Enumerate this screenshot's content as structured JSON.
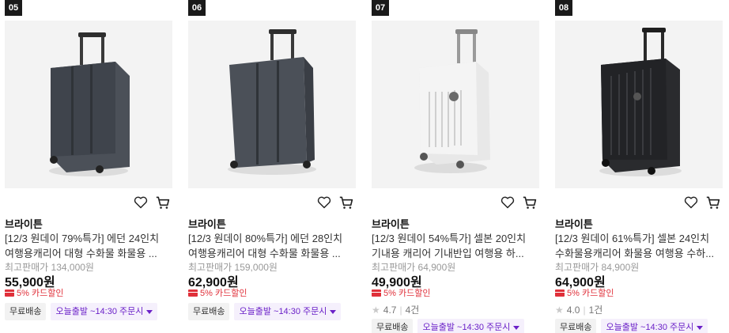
{
  "products": [
    {
      "rank": "05",
      "brand": "브라이튼",
      "title": "[12/3 원데이 79%특가] 에던 24인치 여행용캐리어 대형 수화물 화물용 ...",
      "orig_price": "최고판매가 134,000원",
      "price": "55,900원",
      "discount": "5% 카드할인",
      "rating": null,
      "tags": [
        "무료배송",
        "오늘출발 ~14:30 주문시"
      ],
      "color": "dark-gray"
    },
    {
      "rank": "06",
      "brand": "브라이튼",
      "title": "[12/3 원데이 80%특가] 에던 28인치 여행용캐리어 대형 수화물 화물용 ...",
      "orig_price": "최고판매가 159,000원",
      "price": "62,900원",
      "discount": "5% 카드할인",
      "rating": null,
      "tags": [
        "무료배송",
        "오늘출발 ~14:30 주문시"
      ],
      "color": "dark-gray"
    },
    {
      "rank": "07",
      "brand": "브라이튼",
      "title": "[12/3 원데이 54%특가] 셀본 20인치 기내용 캐리어 기내반입 여행용 하...",
      "orig_price": "최고판매가 64,900원",
      "price": "49,900원",
      "discount": "5% 카드할인",
      "rating": {
        "score": "4.7",
        "count": "4건"
      },
      "tags": [
        "무료배송",
        "오늘출발 ~14:30 주문시"
      ],
      "color": "white"
    },
    {
      "rank": "08",
      "brand": "브라이튼",
      "title": "[12/3 원데이 61%특가] 셀본 24인치 수화물용캐리어 화물용 여행용 수하...",
      "orig_price": "최고판매가 84,900원",
      "price": "64,900원",
      "discount": "5% 카드할인",
      "rating": {
        "score": "4.0",
        "count": "1건"
      },
      "tags": [
        "무료배송",
        "오늘출발 ~14:30 주문시"
      ],
      "color": "black"
    }
  ],
  "colors": {
    "accent_purple": "#6b21c8",
    "discount_red": "#e0303a",
    "badge_bg": "#1a1a1a"
  },
  "icons": {
    "wishlist": "heart-icon",
    "cart": "cart-icon",
    "card": "credit-card-icon",
    "star": "star-icon",
    "dropdown": "triangle-down-icon"
  }
}
